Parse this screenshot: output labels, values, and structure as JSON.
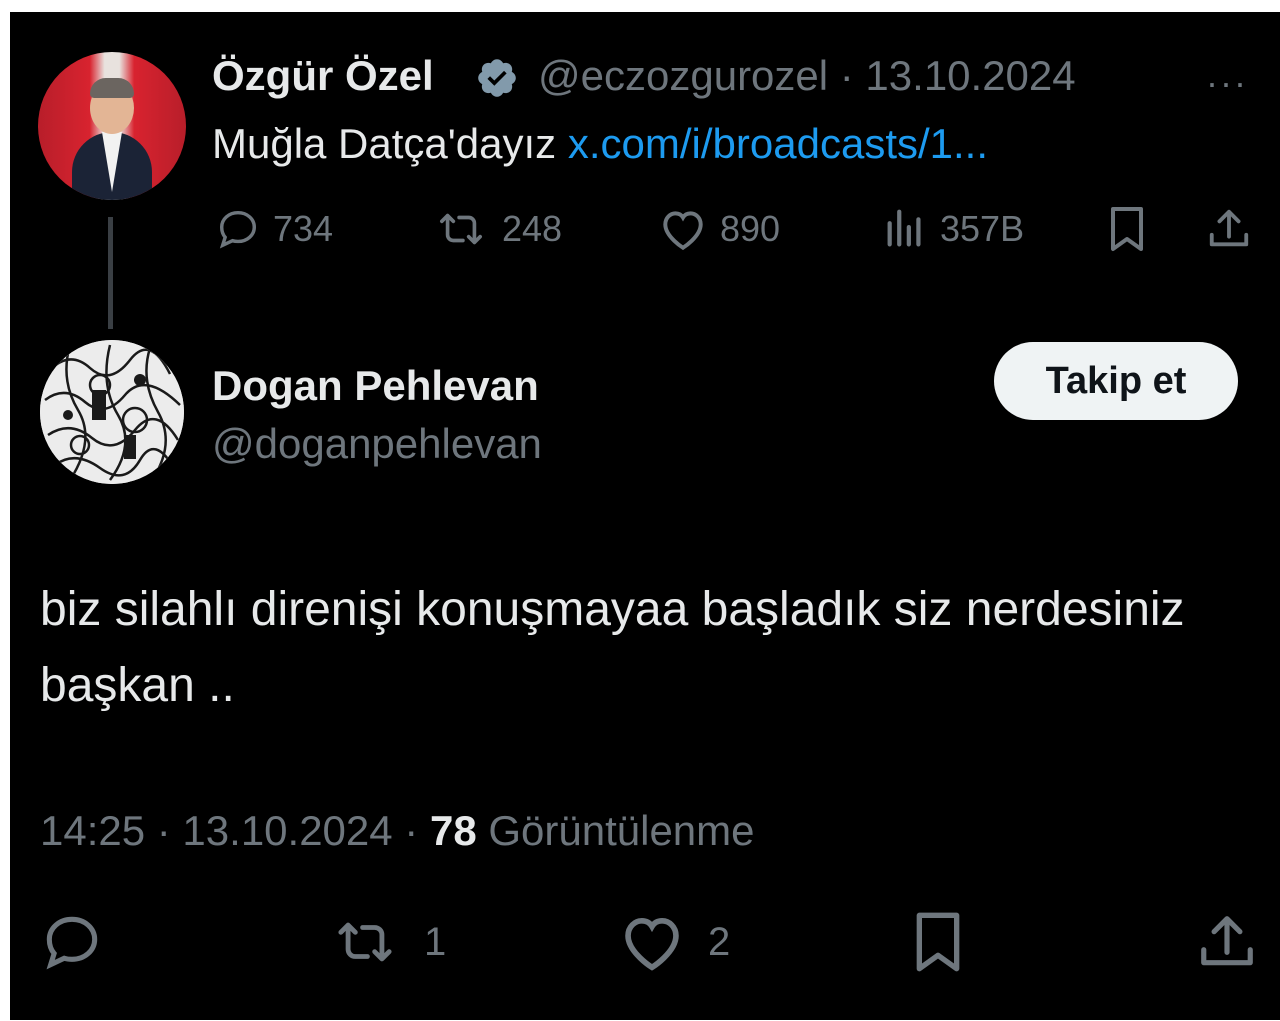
{
  "parent_tweet": {
    "author_name": "Özgür Özel",
    "handle_date": "@eczozgurozel · 13.10.2024",
    "more": "···",
    "text": "Muğla Datça'dayız ",
    "link": "x.com/i/broadcasts/1...",
    "replies": "734",
    "reposts": "248",
    "likes": "890",
    "views": "357B"
  },
  "reply_tweet": {
    "author_name": "Dogan Pehlevan",
    "handle": "@doganpehlevan",
    "follow_label": "Takip et",
    "text": "biz silahlı direnişi konuşmayaa başladık siz nerdesiniz başkan ..",
    "time_date": "14:25 · 13.10.2024 · ",
    "view_count": "78",
    "view_label": " Görüntülenme",
    "reposts": "1",
    "likes": "2"
  },
  "colors": {
    "background": "#000000",
    "text": "#e7e9ea",
    "secondary": "#6e767d",
    "link": "#1d9bf0",
    "verified": "#829aab"
  },
  "icons": [
    "verified-badge-icon",
    "reply-icon",
    "repost-icon",
    "like-icon",
    "views-icon",
    "bookmark-icon",
    "share-icon"
  ]
}
